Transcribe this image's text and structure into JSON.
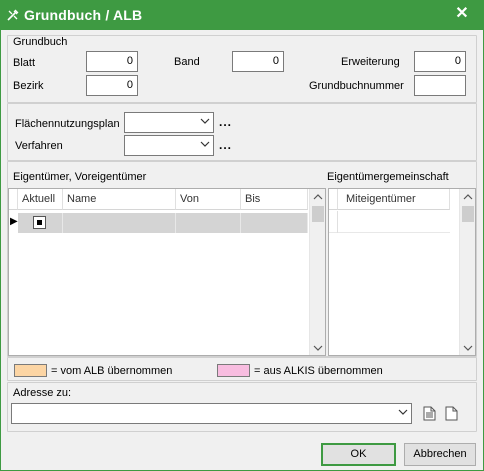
{
  "window": {
    "title": "Grundbuch / ALB",
    "close_glyph": "✕",
    "icon": "tools-icon",
    "accent": "#3e9a42"
  },
  "grundbuch": {
    "group_label": "Grundbuch",
    "blatt_label": "Blatt",
    "blatt_value": "0",
    "band_label": "Band",
    "band_value": "0",
    "erweiterung_label": "Erweiterung",
    "erweiterung_value": "0",
    "bezirk_label": "Bezirk",
    "bezirk_value": "0",
    "grundbuchnummer_label": "Grundbuchnummer",
    "grundbuchnummer_value": ""
  },
  "plan": {
    "flaechen_label": "Flächennutzungsplan",
    "flaechen_value": "",
    "verfahren_label": "Verfahren",
    "verfahren_value": "",
    "more_glyph": "..."
  },
  "owners": {
    "section_label": "Eigentümer, Voreigentümer",
    "columns": [
      "Aktuell",
      "Name",
      "Von",
      "Bis"
    ],
    "row_indicator": "▶",
    "rows": [
      {
        "aktuell": true,
        "name": "",
        "von": "",
        "bis": ""
      }
    ]
  },
  "community": {
    "section_label": "Eigentümergemeinschaft",
    "columns": [
      "Miteigentümer"
    ]
  },
  "legend": {
    "alb_label": "= vom ALB übernommen",
    "alb_color": "#fcd5a4",
    "alkis_label": "= aus ALKIS übernommen",
    "alkis_color": "#f8bde0"
  },
  "address": {
    "label": "Adresse zu:",
    "value": ""
  },
  "buttons": {
    "ok": "OK",
    "cancel": "Abbrechen"
  }
}
